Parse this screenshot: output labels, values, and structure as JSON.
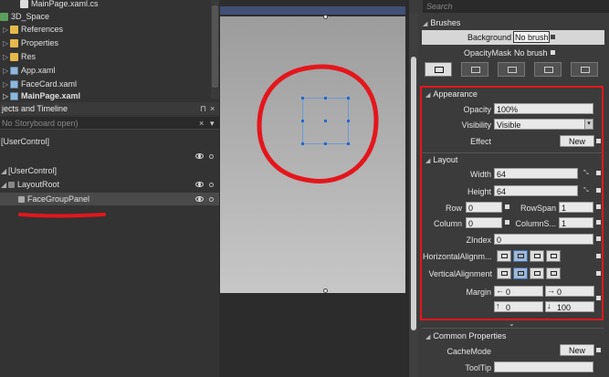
{
  "project_tree": {
    "items": [
      {
        "label": "MainPage.xaml.cs",
        "type": "file"
      },
      {
        "label": "3D_Space",
        "type": "project"
      },
      {
        "label": "References",
        "type": "folder"
      },
      {
        "label": "Properties",
        "type": "folder"
      },
      {
        "label": "Res",
        "type": "folder"
      },
      {
        "label": "App.xaml",
        "type": "xaml"
      },
      {
        "label": "FaceCard.xaml",
        "type": "xaml"
      },
      {
        "label": "MainPage.xaml",
        "type": "xaml"
      }
    ]
  },
  "objects_panel": {
    "title": "jects and Timeline",
    "storyboard": "No Storyboard open)",
    "scope": "[UserControl]",
    "tree": [
      {
        "label": "[UserControl]"
      },
      {
        "label": "LayoutRoot"
      },
      {
        "label": "FaceGroupPanel"
      }
    ]
  },
  "search": {
    "placeholder": "Search"
  },
  "brushes": {
    "header": "Brushes",
    "rows": [
      {
        "label": "Background",
        "value": "No brush"
      },
      {
        "label": "OpacityMask",
        "value": "No brush"
      }
    ]
  },
  "appearance": {
    "header": "Appearance",
    "opacity_label": "Opacity",
    "opacity_value": "100%",
    "visibility_label": "Visibility",
    "visibility_value": "Visible",
    "effect_label": "Effect",
    "effect_button": "New"
  },
  "layout": {
    "header": "Layout",
    "width_label": "Width",
    "width_value": "64",
    "height_label": "Height",
    "height_value": "64",
    "row_label": "Row",
    "row_value": "0",
    "rowspan_label": "RowSpan",
    "rowspan_value": "1",
    "column_label": "Column",
    "column_value": "0",
    "columnspan_label": "ColumnS...",
    "columnspan_value": "1",
    "zindex_label": "ZIndex",
    "zindex_value": "0",
    "halign_label": "HorizontalAlignm...",
    "valign_label": "VerticalAlignment",
    "margin_label": "Margin",
    "margin_left": "0",
    "margin_right": "0",
    "margin_top": "0",
    "margin_bottom": "100"
  },
  "common": {
    "header": "Common Properties",
    "cachemode_label": "CacheMode",
    "cachemode_button": "New",
    "tooltip_label": "ToolTip"
  },
  "colors": {
    "annotation_red": "#e4161c",
    "selection_blue": "#2468c8"
  }
}
